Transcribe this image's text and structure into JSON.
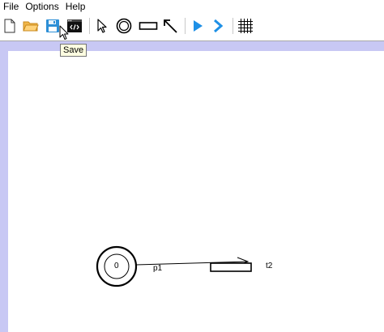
{
  "menu": {
    "items": [
      "File",
      "Options",
      "Help"
    ]
  },
  "toolbar": {
    "buttons": [
      {
        "name": "new-file",
        "icon": "new-file-icon"
      },
      {
        "name": "open",
        "icon": "folder-open-icon"
      },
      {
        "name": "save",
        "icon": "save-floppy-icon"
      },
      {
        "name": "source",
        "icon": "code-window-icon"
      },
      {
        "name": "select",
        "icon": "select-arrow-icon"
      },
      {
        "name": "place",
        "icon": "place-circle-icon"
      },
      {
        "name": "transition",
        "icon": "transition-rect-icon"
      },
      {
        "name": "arc",
        "icon": "arc-arrow-icon"
      },
      {
        "name": "play",
        "icon": "play-icon"
      },
      {
        "name": "step",
        "icon": "step-chevron-icon"
      },
      {
        "name": "grid",
        "icon": "grid-icon"
      }
    ],
    "accent_color": "#1e90e6"
  },
  "tooltip": {
    "text": "Save"
  },
  "canvas": {
    "frame_color": "#c8c8f4",
    "place": {
      "token_count": "0",
      "label": "p1"
    },
    "transition": {
      "label": "t2"
    }
  }
}
